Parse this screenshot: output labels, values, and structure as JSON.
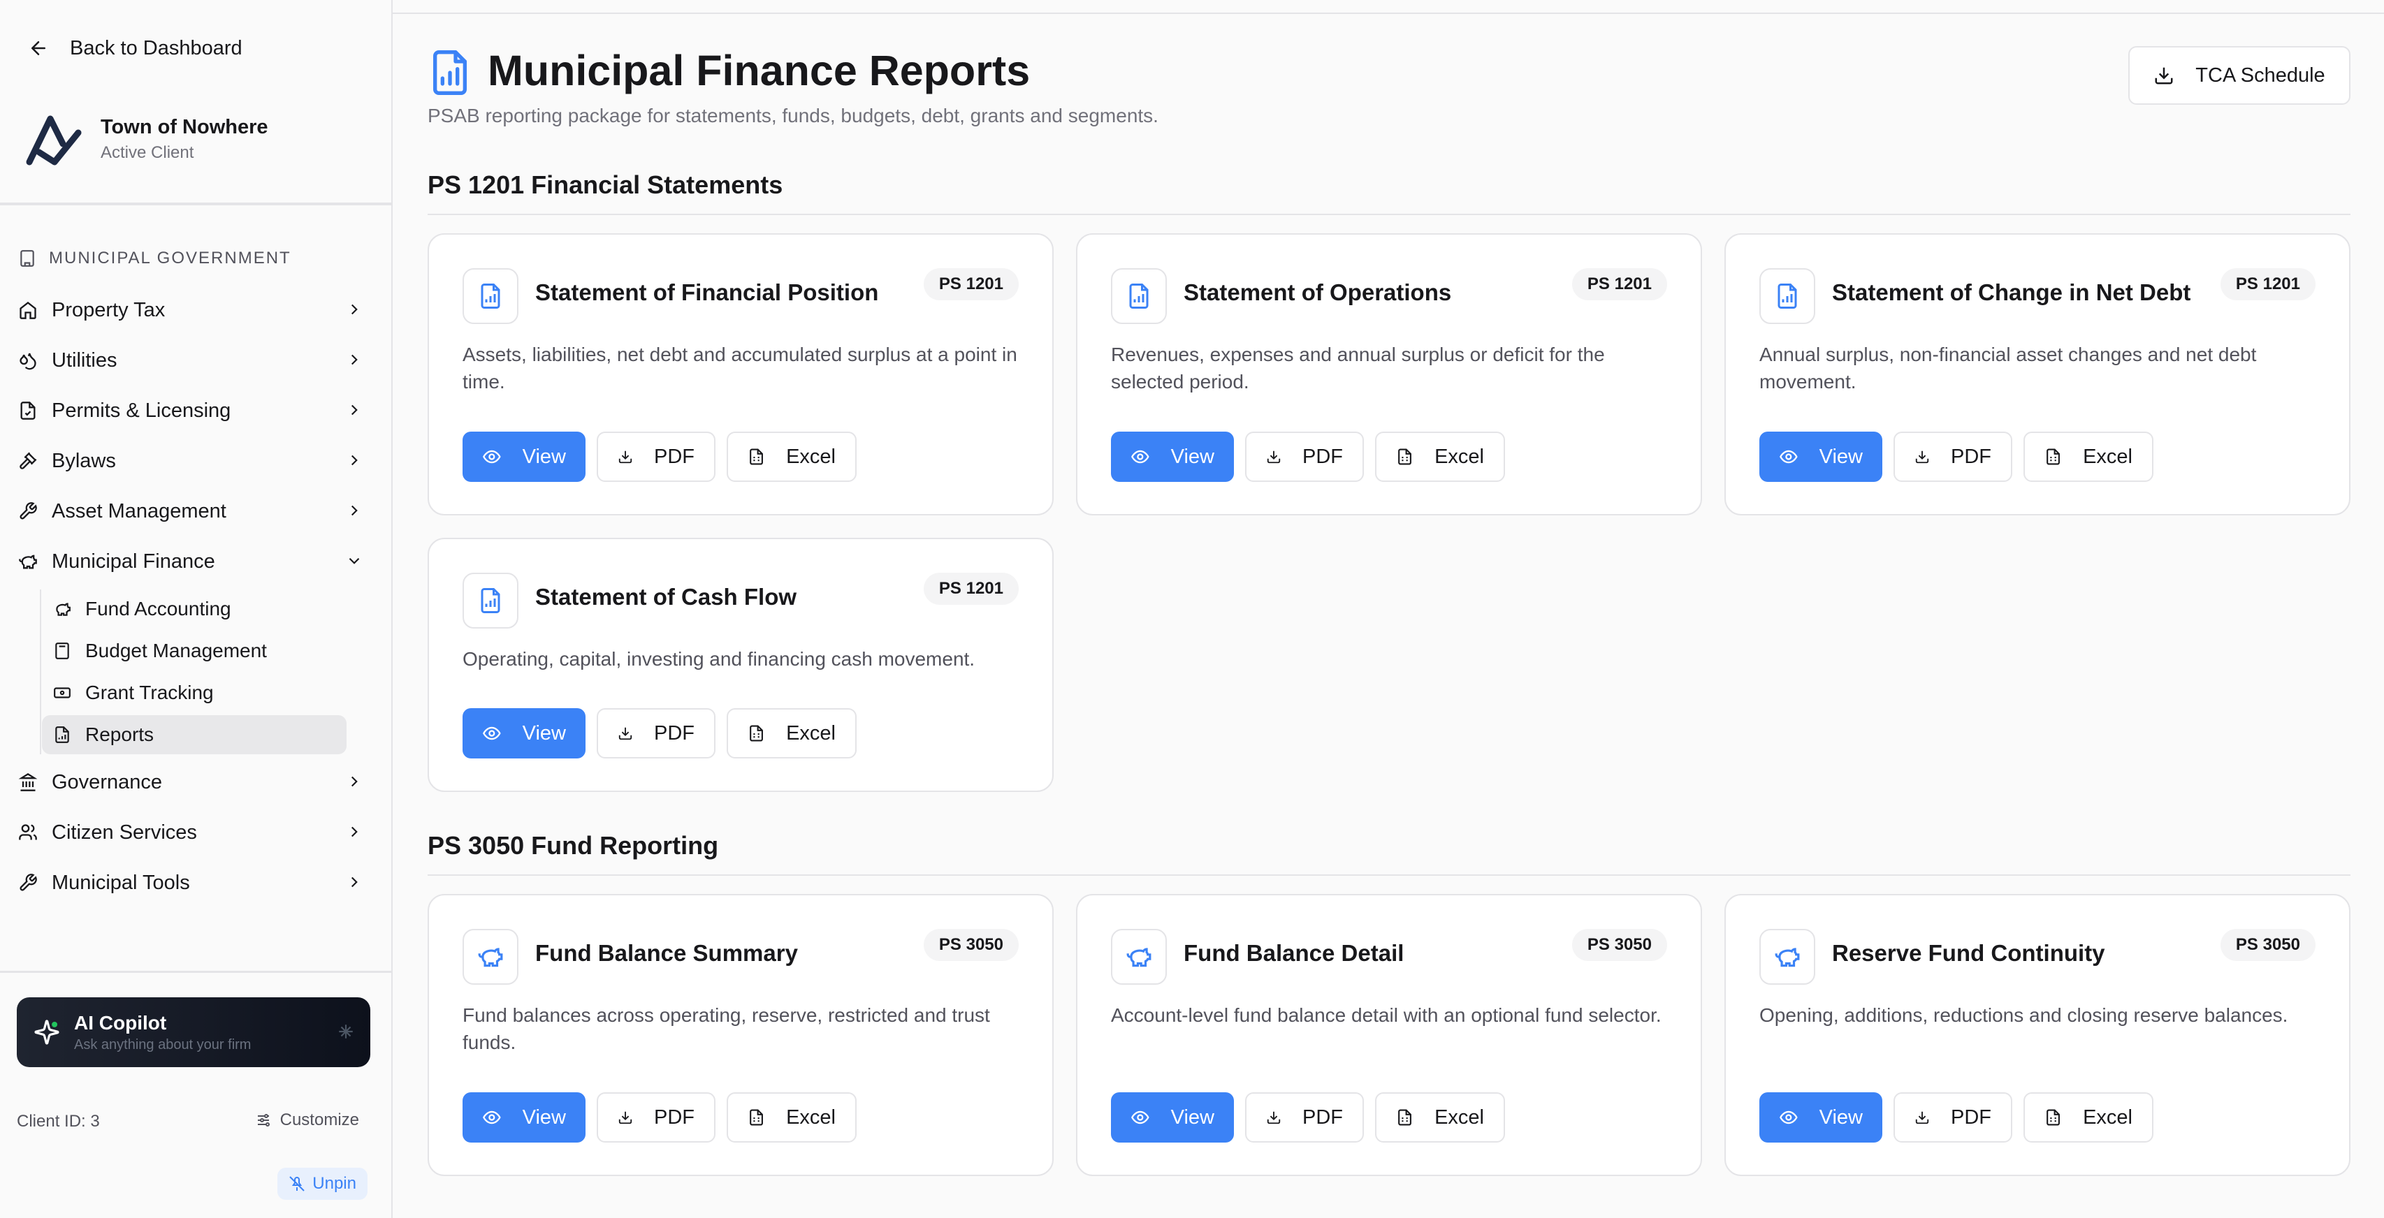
{
  "sidebar": {
    "back_label": "Back to Dashboard",
    "client": {
      "name": "Town of Nowhere",
      "status": "Active Client"
    },
    "section_label": "Municipal Government",
    "items": [
      {
        "label": "Property Tax",
        "icon": "home-icon"
      },
      {
        "label": "Utilities",
        "icon": "droplets-icon"
      },
      {
        "label": "Permits & Licensing",
        "icon": "file-check-icon"
      },
      {
        "label": "Bylaws",
        "icon": "gavel-icon"
      },
      {
        "label": "Asset Management",
        "icon": "wrench-icon"
      },
      {
        "label": "Municipal Finance",
        "icon": "piggy-bank-icon"
      }
    ],
    "sub_items": [
      {
        "label": "Fund Accounting",
        "icon": "piggy-bank-icon"
      },
      {
        "label": "Budget Management",
        "icon": "calculator-icon"
      },
      {
        "label": "Grant Tracking",
        "icon": "banknote-icon"
      },
      {
        "label": "Reports",
        "icon": "file-chart-icon",
        "active": true
      }
    ],
    "items_after": [
      {
        "label": "Governance",
        "icon": "landmark-icon"
      },
      {
        "label": "Citizen Services",
        "icon": "users-icon"
      },
      {
        "label": "Municipal Tools",
        "icon": "wrench-icon"
      }
    ],
    "copilot": {
      "title": "AI Copilot",
      "subtitle": "Ask anything about your firm"
    },
    "client_id": "Client ID: 3",
    "customize_label": "Customize",
    "unpin_label": "Unpin"
  },
  "header": {
    "title": "Municipal Finance Reports",
    "subtitle": "PSAB reporting package for statements, funds, budgets, debt, grants and segments.",
    "tca_label": "TCA Schedule"
  },
  "sections": [
    {
      "title": "PS 1201 Financial Statements",
      "cards": [
        {
          "title": "Statement of Financial Position",
          "badge": "PS 1201",
          "description": "Assets, liabilities, net debt and accumulated surplus at a point in time."
        },
        {
          "title": "Statement of Operations",
          "badge": "PS 1201",
          "description": "Revenues, expenses and annual surplus or deficit for the selected period."
        },
        {
          "title": "Statement of Change in Net Debt",
          "badge": "PS 1201",
          "description": "Annual surplus, non-financial asset changes and net debt movement."
        },
        {
          "title": "Statement of Cash Flow",
          "badge": "PS 1201",
          "description": "Operating, capital, investing and financing cash movement."
        }
      ]
    },
    {
      "title": "PS 3050 Fund Reporting",
      "cards": [
        {
          "title": "Fund Balance Summary",
          "badge": "PS 3050",
          "description": "Fund balances across operating, reserve, restricted and trust funds."
        },
        {
          "title": "Fund Balance Detail",
          "badge": "PS 3050",
          "description": "Account-level fund balance detail with an optional fund selector."
        },
        {
          "title": "Reserve Fund Continuity",
          "badge": "PS 3050",
          "description": "Opening, additions, reductions and closing reserve balances."
        }
      ]
    }
  ],
  "actions": {
    "view": "View",
    "pdf": "PDF",
    "excel": "Excel"
  },
  "colors": {
    "accent": "#3b82f6",
    "border": "#e4e4e7",
    "text": "#18181b",
    "muted": "#71717a"
  }
}
